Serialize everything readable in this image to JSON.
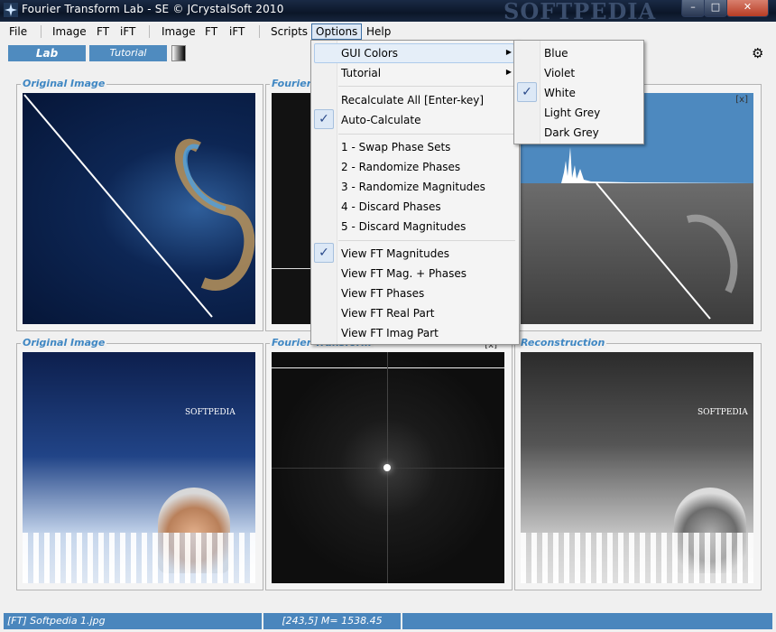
{
  "window": {
    "title": "Fourier Transform Lab - SE  © JCrystalSoft 2010",
    "watermark": "SOFTPEDIA",
    "controls": [
      "minimize",
      "maximize",
      "close"
    ]
  },
  "menubar": {
    "file": "File",
    "image1": "Image",
    "ft1": "FT",
    "ift1": "iFT",
    "image2": "Image",
    "ft2": "FT",
    "ift2": "iFT",
    "scripts": "Scripts",
    "options": "Options",
    "help": "Help"
  },
  "toolbar": {
    "lab": "Lab",
    "tutorial": "Tutorial",
    "settings_icon": "gear-icon"
  },
  "panels": {
    "top_left": {
      "label": "Original Image"
    },
    "top_middle": {
      "label": "Fourier"
    },
    "top_right": {
      "close": "[x]"
    },
    "bottom_left": {
      "label": "Original Image"
    },
    "bottom_middle": {
      "label": "Fourier Transform",
      "close": "[x]"
    },
    "bottom_right": {
      "label": "Reconstruction"
    }
  },
  "options_menu": {
    "gui_colors": "GUI Colors",
    "tutorial": "Tutorial",
    "recalculate": "Recalculate All [Enter-key]",
    "auto_calculate": "Auto-Calculate",
    "swap_phase": "1 - Swap Phase Sets",
    "randomize_phases": "2 - Randomize Phases",
    "randomize_magnitudes": "3 - Randomize Magnitudes",
    "discard_phases": "4 - Discard Phases",
    "discard_magnitudes": "5 - Discard Magnitudes",
    "view_magnitudes": "View FT Magnitudes",
    "view_mag_phases": "View FT Mag. + Phases",
    "view_phases": "View FT Phases",
    "view_real": "View FT Real Part",
    "view_imag": "View FT Imag Part",
    "checked": [
      "auto_calculate",
      "view_magnitudes"
    ]
  },
  "colors_menu": {
    "blue": "Blue",
    "violet": "Violet",
    "white": "White",
    "light_grey": "Light Grey",
    "dark_grey": "Dark Grey",
    "selected": "white"
  },
  "status": {
    "file": "[FT] Softpedia 1.jpg",
    "coords": "[243,5]  M= 1538.45"
  },
  "image_text": {
    "softpedia": "SOFTPEDIA"
  },
  "colors": {
    "accent": "#4f8bbf",
    "label": "#3f87c3",
    "titlebar": "#0b1628"
  }
}
